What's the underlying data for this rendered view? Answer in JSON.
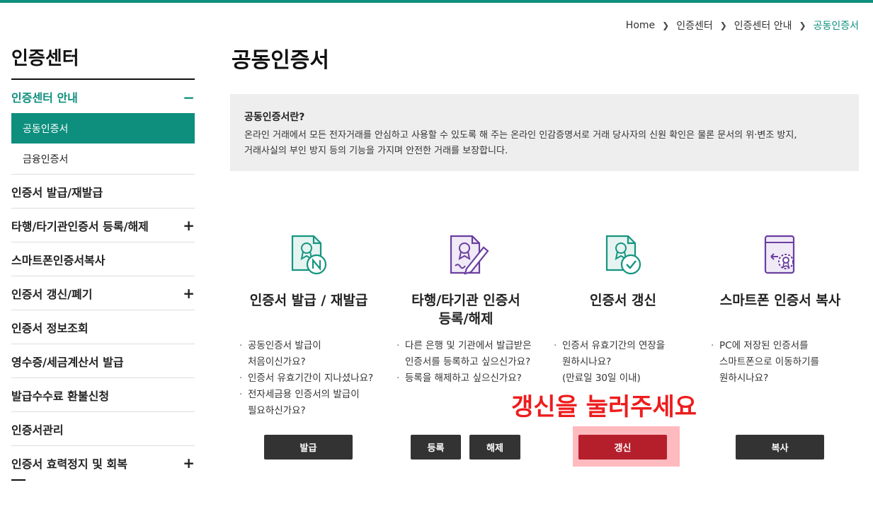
{
  "breadcrumb": [
    "Home",
    "인증센터",
    "인증센터 안내",
    "공동인증서"
  ],
  "sidebar": {
    "title": "인증센터",
    "items": [
      {
        "label": "인증센터 안내",
        "toggle": "−",
        "open": true
      },
      {
        "label": "인증서 발급/재발급",
        "toggle": ""
      },
      {
        "label": "타행/타기관인증서 등록/해제",
        "toggle": "+"
      },
      {
        "label": "스마트폰인증서복사",
        "toggle": ""
      },
      {
        "label": "인증서 갱신/폐기",
        "toggle": "+"
      },
      {
        "label": "인증서 정보조회",
        "toggle": ""
      },
      {
        "label": "영수증/세금계산서 발급",
        "toggle": ""
      },
      {
        "label": "발급수수료 환불신청",
        "toggle": ""
      },
      {
        "label": "인증서관리",
        "toggle": ""
      },
      {
        "label": "인증서 효력정지 및 회복",
        "toggle": "+"
      }
    ],
    "subitems": [
      {
        "label": "공동인증서",
        "active": true
      },
      {
        "label": "금융인증서",
        "active": false
      }
    ]
  },
  "page_title": "공동인증서",
  "info": {
    "question": "공동인증서란?",
    "line1": "온라인 거래에서 모든 전자거래를 안심하고 사용할 수 있도록 해 주는 온라인 인감증명서로 거래 당사자의 신원 확인은 물론 문서의 위·변조 방지,",
    "line2": "거래사실의 부인 방지 등의 기능을 가지며 안전한 거래를 보장합니다."
  },
  "cards": [
    {
      "title": "인증서 발급 / 재발급",
      "icon": "certificate-issue-icon",
      "bullets": [
        "공동인증서 발급이",
        "처음이신가요?",
        "인증서 유효기간이 지나셨나요?",
        "전자세금용 인증서의 발급이",
        "필요하신가요?"
      ],
      "buttons": [
        "발급"
      ]
    },
    {
      "title_line1": "타행/타기관 인증서",
      "title_line2": "등록/해제",
      "icon": "certificate-register-icon",
      "bullets": [
        "다른 은행 및 기관에서 발급받은",
        "인증서를 등록하고 싶으신가요?",
        "등록을 해제하고 싶으신가요?"
      ],
      "buttons": [
        "등록",
        "해제"
      ]
    },
    {
      "title": "인증서 갱신",
      "icon": "certificate-renew-icon",
      "bullets": [
        "인증서 유효기간의 연장을",
        "원하시나요?",
        "(만료일 30일 이내)"
      ],
      "buttons": [
        "갱신"
      ]
    },
    {
      "title": "스마트폰 인증서 복사",
      "icon": "smartphone-copy-icon",
      "bullets": [
        "PC에 저장된 인증서를",
        "스마트폰으로 이동하기를",
        "원하시나요?"
      ],
      "buttons": [
        "복사"
      ]
    }
  ],
  "annotation": "갱신을 눌러주세요",
  "colors": {
    "accent": "#0e8f7e",
    "renew_button": "#b51f2b",
    "annotation": "#ee1c1c",
    "icon_green": "#16957f",
    "icon_purple": "#6b3fa0"
  }
}
